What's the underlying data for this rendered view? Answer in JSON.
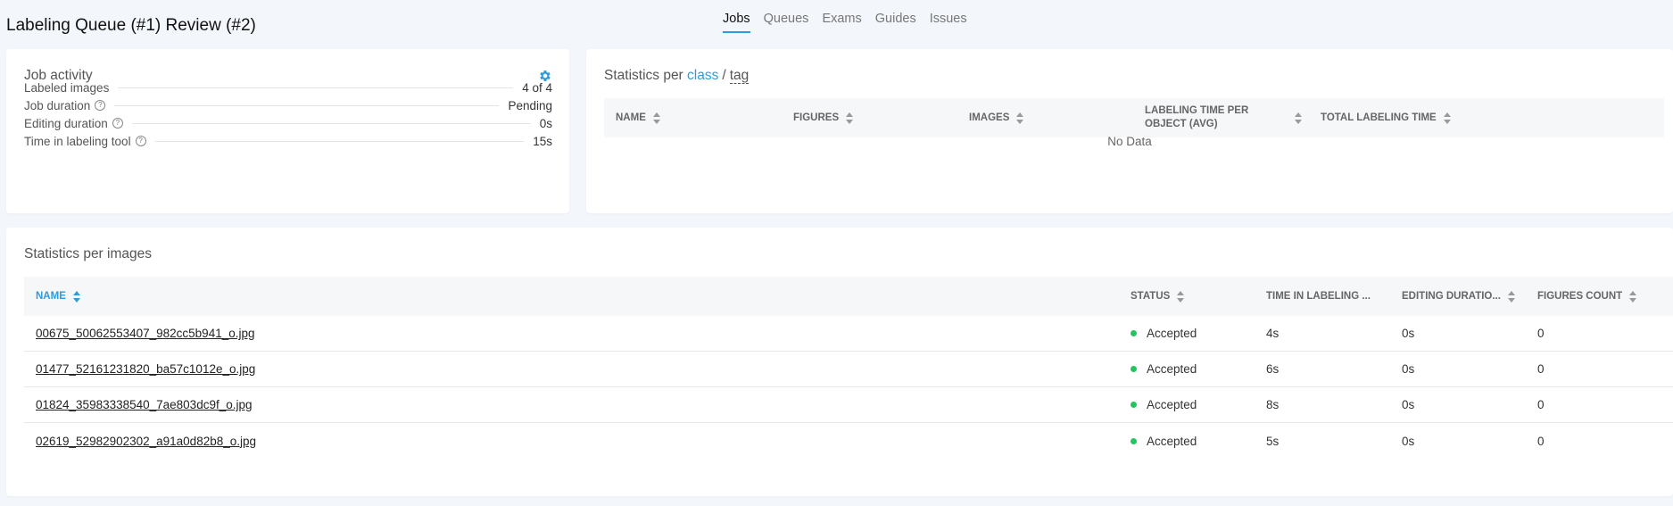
{
  "page": {
    "title": "Labeling Queue (#1) Review (#2)",
    "nav": [
      {
        "label": "Jobs",
        "active": true
      },
      {
        "label": "Queues",
        "active": false
      },
      {
        "label": "Exams",
        "active": false
      },
      {
        "label": "Guides",
        "active": false
      },
      {
        "label": "Issues",
        "active": false
      }
    ]
  },
  "job_activity": {
    "title": "Job activity",
    "settings_icon": "gear-icon",
    "rows": [
      {
        "label": "Labeled images",
        "value": "4 of 4",
        "help": false
      },
      {
        "label": "Job duration",
        "value": "Pending",
        "help": true
      },
      {
        "label": "Editing duration",
        "value": "0s",
        "help": true
      },
      {
        "label": "Time in labeling tool",
        "value": "15s",
        "help": true
      }
    ]
  },
  "class_stats": {
    "title_prefix": "Statistics per",
    "title_class": "class",
    "title_sep": "/",
    "title_tag": "tag",
    "columns": [
      "NAME",
      "FIGURES",
      "IMAGES",
      "LABELING TIME PER OBJECT (AVG)",
      "TOTAL LABELING TIME"
    ],
    "empty_text": "No Data"
  },
  "image_stats": {
    "title": "Statistics per images",
    "columns": [
      "NAME",
      "STATUS",
      "TIME IN LABELING ...",
      "EDITING DURATIO...",
      "FIGURES COUNT"
    ],
    "rows": [
      {
        "name": "00675_50062553407_982cc5b941_o.jpg",
        "status": "Accepted",
        "time": "4s",
        "editing": "0s",
        "figures": "0"
      },
      {
        "name": "01477_52161231820_ba57c1012e_o.jpg",
        "status": "Accepted",
        "time": "6s",
        "editing": "0s",
        "figures": "0"
      },
      {
        "name": "01824_35983338540_7ae803dc9f_o.jpg",
        "status": "Accepted",
        "time": "8s",
        "editing": "0s",
        "figures": "0"
      },
      {
        "name": "02619_52982902302_a91a0d82b8_o.jpg",
        "status": "Accepted",
        "time": "5s",
        "editing": "0s",
        "figures": "0"
      }
    ],
    "status_color": "#22c55e"
  },
  "colors": {
    "accent": "#2d9cdb"
  }
}
